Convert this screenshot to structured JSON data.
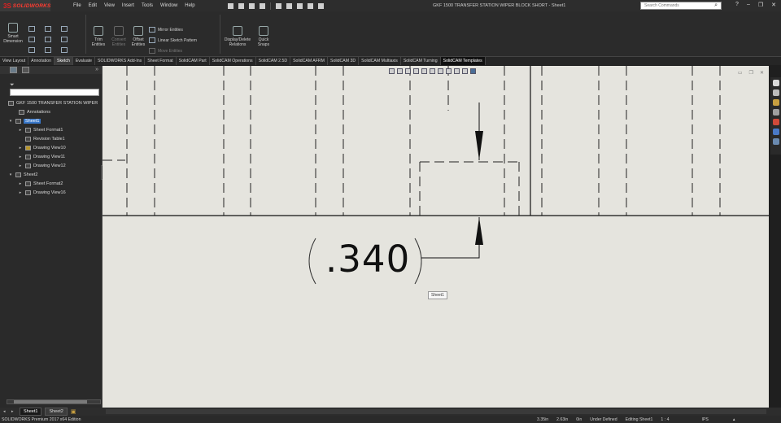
{
  "app": {
    "logo_brand": "SOLIDWORKS",
    "logo_mark": "3S",
    "document_title": "GKF 1500 TRANSFER STATION WIPER BLOCK SHORT - Sheet1"
  },
  "menu": [
    "File",
    "Edit",
    "View",
    "Insert",
    "Tools",
    "Window",
    "Help"
  ],
  "search": {
    "placeholder": "Search Commands"
  },
  "ribbon": {
    "smart_dimension": "Smart\nDimension",
    "trim_entities": "Trim\nEntities",
    "convert_entities": "Convert\nEntities",
    "offset_entities": "Offset\nEntities",
    "mirror_entities": "Mirror Entities",
    "linear_sketch_pattern": "Linear Sketch Pattern",
    "move_entities": "Move Entities",
    "display_delete_relations": "Display/Delete\nRelations",
    "quick_snaps": "Quick\nSnaps"
  },
  "tabs": [
    {
      "label": "View Layout"
    },
    {
      "label": "Annotation"
    },
    {
      "label": "Sketch"
    },
    {
      "label": "Evaluate"
    },
    {
      "label": "SOLIDWORKS Add-Ins"
    },
    {
      "label": "Sheet Format"
    },
    {
      "label": "SolidCAM Part"
    },
    {
      "label": "SolidCAM Operations"
    },
    {
      "label": "SolidCAM 2.5D"
    },
    {
      "label": "SolidCAM AFRM"
    },
    {
      "label": "SolidCAM 3D"
    },
    {
      "label": "SolidCAM Multiaxis"
    },
    {
      "label": "SolidCAM Turning"
    },
    {
      "label": "SolidCAM Templates"
    }
  ],
  "tree": {
    "root": "GKF 1500 TRANSFER STATION WIPER",
    "items": [
      {
        "label": "Annotations"
      },
      {
        "label": "Sheet1"
      },
      {
        "label": "Sheet Format1"
      },
      {
        "label": "Revision Table1"
      },
      {
        "label": "Drawing View10"
      },
      {
        "label": "Drawing View11"
      },
      {
        "label": "Drawing View12"
      },
      {
        "label": "Sheet2"
      },
      {
        "label": "Sheet Format2"
      },
      {
        "label": "Drawing View16"
      }
    ]
  },
  "canvas": {
    "dimension_text": ".340",
    "tooltip": "Sheet1"
  },
  "sheet_tabs": [
    {
      "label": "Sheet1"
    },
    {
      "label": "Sheet2"
    }
  ],
  "status": {
    "edition": "SOLIDWORKS Premium 2017 x64 Edition",
    "x": "3.35in",
    "y": "2.63in",
    "z": "0in",
    "definition": "Under Defined",
    "editing": "Editing Sheet1",
    "scale": "1 : 4",
    "units": "IPS"
  },
  "colors": {
    "canvas_bg": "#e5e4de",
    "ui_dark": "#2b2b2b",
    "selection": "#3877c9",
    "brand_red": "#e02020"
  }
}
